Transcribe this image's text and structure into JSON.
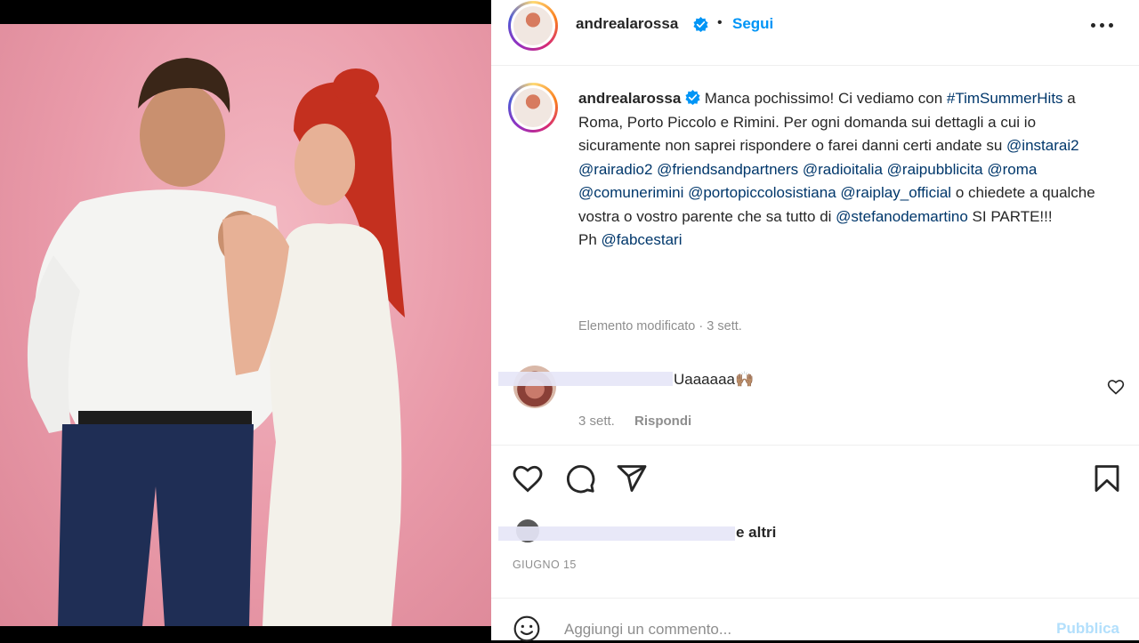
{
  "post": {
    "username": "andrealarossa",
    "separator": "•",
    "follow_label": "Segui",
    "more_icon": "more-horizontal-icon"
  },
  "caption": {
    "username": "andrealarossa",
    "t1": "Manca pochissimo! Ci vediamo con",
    "hashtag": "#TimSummerHits",
    "t2": "a Roma, Porto Piccolo e Rimini. Per ogni domanda sui dettagli a cui io sicuramente non saprei rispondere o farei danni certi andate su",
    "m1": "@instarai2",
    "m2": "@rairadio2",
    "m3": "@friendsandpartners",
    "m4": "@radioitalia",
    "m5": "@raipubblicita",
    "m6": "@roma",
    "m7": "@comunerimini",
    "m8": "@portopiccolosistiana",
    "m9": "@raiplay_official",
    "t3": "o chiedete a qualche vostra o vostro parente che sa tutto di",
    "m10": "@stefanodemartino",
    "t4": "SI PARTE!!!",
    "ph": "Ph",
    "m11": "@fabcestari",
    "edited": "Elemento modificato",
    "time_sep": "·",
    "time": "3 sett."
  },
  "comment": {
    "text": "Uaaaaaa🙌🏽",
    "time": "3 sett.",
    "reply_label": "Rispondi"
  },
  "actions": {
    "likes_suffix": "e altri",
    "date": "GIUGNO 15"
  },
  "add_comment": {
    "placeholder": "Aggiungi un commento...",
    "publish_label": "Pubblica"
  },
  "colors": {
    "link": "#00376b",
    "follow": "#0095f6",
    "publish_disabled": "#b2dffc",
    "photo_bg": "#e99aa9"
  }
}
